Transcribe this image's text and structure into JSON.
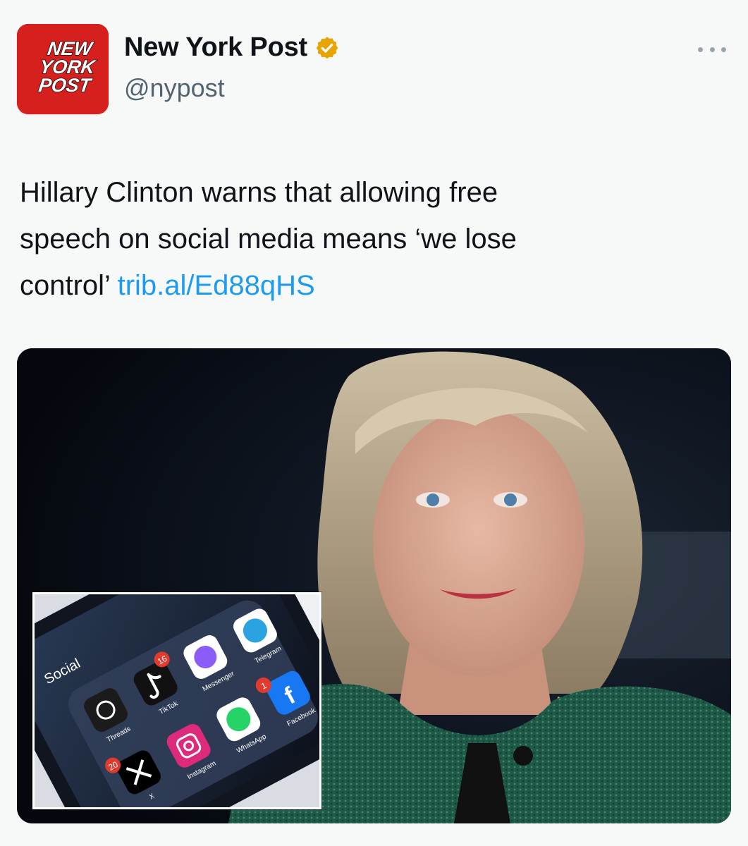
{
  "account": {
    "display_name": "New York Post",
    "handle": "@nypost",
    "logo_text": [
      "NEW",
      "YORK",
      "POST"
    ],
    "verified": true,
    "avatar_color": "#d5201e",
    "verified_color": "#e8a400"
  },
  "tweet": {
    "text_lines": [
      "Hillary Clinton warns that allowing free",
      "speech on social media means ‘we lose",
      "control’ "
    ],
    "link": "trib.al/Ed88qHS",
    "link_color": "#1d9bf0"
  },
  "media": {
    "inset": {
      "folder_label": "Social",
      "app_labels": [
        "Threads",
        "TikTok",
        "Messenger",
        "Telegram",
        "Instagram",
        "X",
        "WhatsApp",
        "Facebook"
      ],
      "badges": [
        "16",
        "20",
        "1"
      ]
    }
  },
  "icons": {
    "verified": "verified-badge-icon",
    "more": "more-options-icon"
  }
}
